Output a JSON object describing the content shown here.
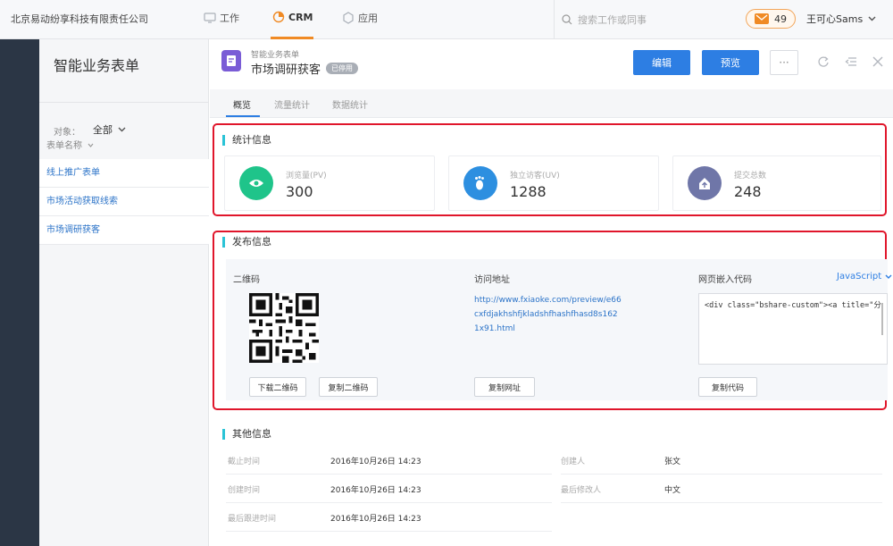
{
  "topbar": {
    "company": "北京易动纷享科技有限责任公司",
    "nav": [
      {
        "label": "工作",
        "icon": "monitor-icon"
      },
      {
        "label": "CRM",
        "icon": "pie-chart-icon"
      },
      {
        "label": "应用",
        "icon": "apps-icon"
      }
    ],
    "search_placeholder": "搜索工作或同事",
    "message_count": "49",
    "user_name": "王可心Sams"
  },
  "sidebar": {
    "title": "智能业务表单",
    "filter_label": "对象：",
    "filter_value": "全部",
    "column_header": "表单名称",
    "items": [
      "线上推广表单",
      "市场活动获取线索",
      "市场调研获客"
    ]
  },
  "header": {
    "subtitle": "智能业务表单",
    "title": "市场调研获客",
    "status_badge": "已停用",
    "edit_label": "编辑",
    "preview_label": "预览",
    "more_label": "···"
  },
  "tabs": [
    {
      "label": "概览",
      "active": true
    },
    {
      "label": "流量统计",
      "active": false
    },
    {
      "label": "数据统计",
      "active": false
    }
  ],
  "stats": {
    "section_title": "统计信息",
    "cards": [
      {
        "label": "浏览量(PV)",
        "value": "300",
        "color": "#1fc48a",
        "icon": "eye-icon"
      },
      {
        "label": "独立访客(UV)",
        "value": "1288",
        "color": "#2d8fe0",
        "icon": "footprint-icon"
      },
      {
        "label": "提交总数",
        "value": "248",
        "color": "#6f76a8",
        "icon": "upload-icon"
      }
    ]
  },
  "publish": {
    "section_title": "发布信息",
    "qr_title": "二维码",
    "download_qr_label": "下载二维码",
    "copy_qr_label": "复制二维码",
    "url_title": "访问地址",
    "url": "http://www.fxiaoke.com/preview/e66cxfdjakhshfjkladshfhashfhasd8s1621x91.html",
    "copy_url_label": "复制网址",
    "embed_title": "网页嵌入代码",
    "embed_language": "JavaScript",
    "embed_code": "<div class=\"bshare-custom\"><a title=\"分",
    "copy_code_label": "复制代码"
  },
  "other": {
    "section_title": "其他信息",
    "left": [
      {
        "label": "截止时间",
        "value": "2016年10月26日 14:23"
      },
      {
        "label": "创建时间",
        "value": "2016年10月26日 14:23"
      },
      {
        "label": "最后跟进时间",
        "value": "2016年10月26日 14:23"
      }
    ],
    "right": [
      {
        "label": "创建人",
        "value": "张文"
      },
      {
        "label": "最后修改人",
        "value": "中文"
      }
    ]
  }
}
